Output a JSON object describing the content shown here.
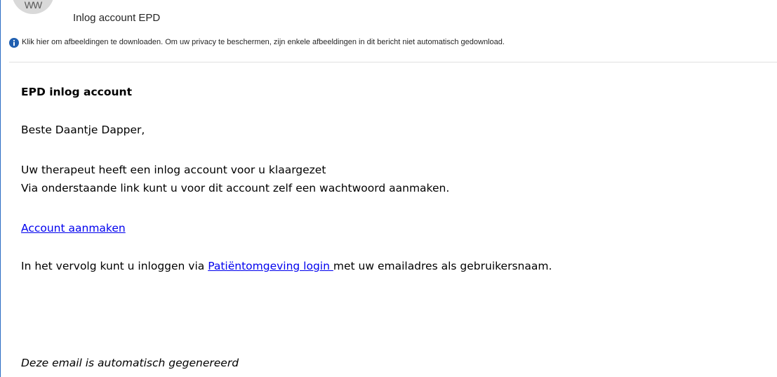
{
  "header": {
    "avatar_initials": "WW",
    "subject": "Inlog account EPD",
    "info_text": "Klik hier om afbeeldingen te downloaden. Om uw privacy te beschermen, zijn enkele afbeeldingen in dit bericht niet automatisch gedownload.",
    "info_icon": "info-icon"
  },
  "message": {
    "heading": "EPD inlog account",
    "greeting": "Beste Daantje Dapper,",
    "para1_line1": "Uw therapeut heeft een inlog account voor u klaargezet",
    "para1_line2": "Via onderstaande link kunt u voor dit account zelf een wachtwoord aanmaken.",
    "create_account_link": "Account aanmaken",
    "login_prefix": "In het vervolg kunt u inloggen via ",
    "login_link": "Patiëntomgeving login ",
    "login_suffix": "met uw emailadres als gebruikersnaam.",
    "footer": "Deze email is automatisch gegenereerd"
  },
  "colors": {
    "link": "#0000ee",
    "info_icon": "#1f5fb0",
    "left_rule": "#2b6cc4"
  }
}
